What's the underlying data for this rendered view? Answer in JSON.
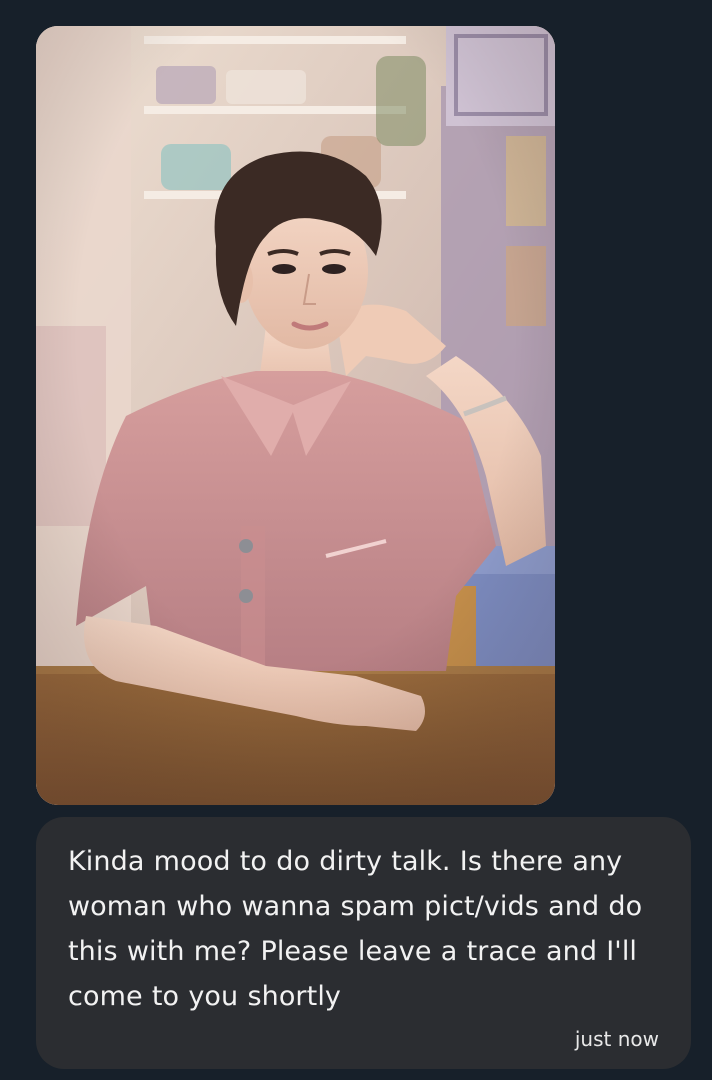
{
  "message": {
    "text": "Kinda mood to do dirty talk. Is there any woman who wanna spam pict/vids and do this with me? Please leave a trace and I'll come to you shortly",
    "timestamp": "just now"
  },
  "colors": {
    "background": "#17202a",
    "bubble": "#2b2d31",
    "text": "#f2f2f2"
  }
}
